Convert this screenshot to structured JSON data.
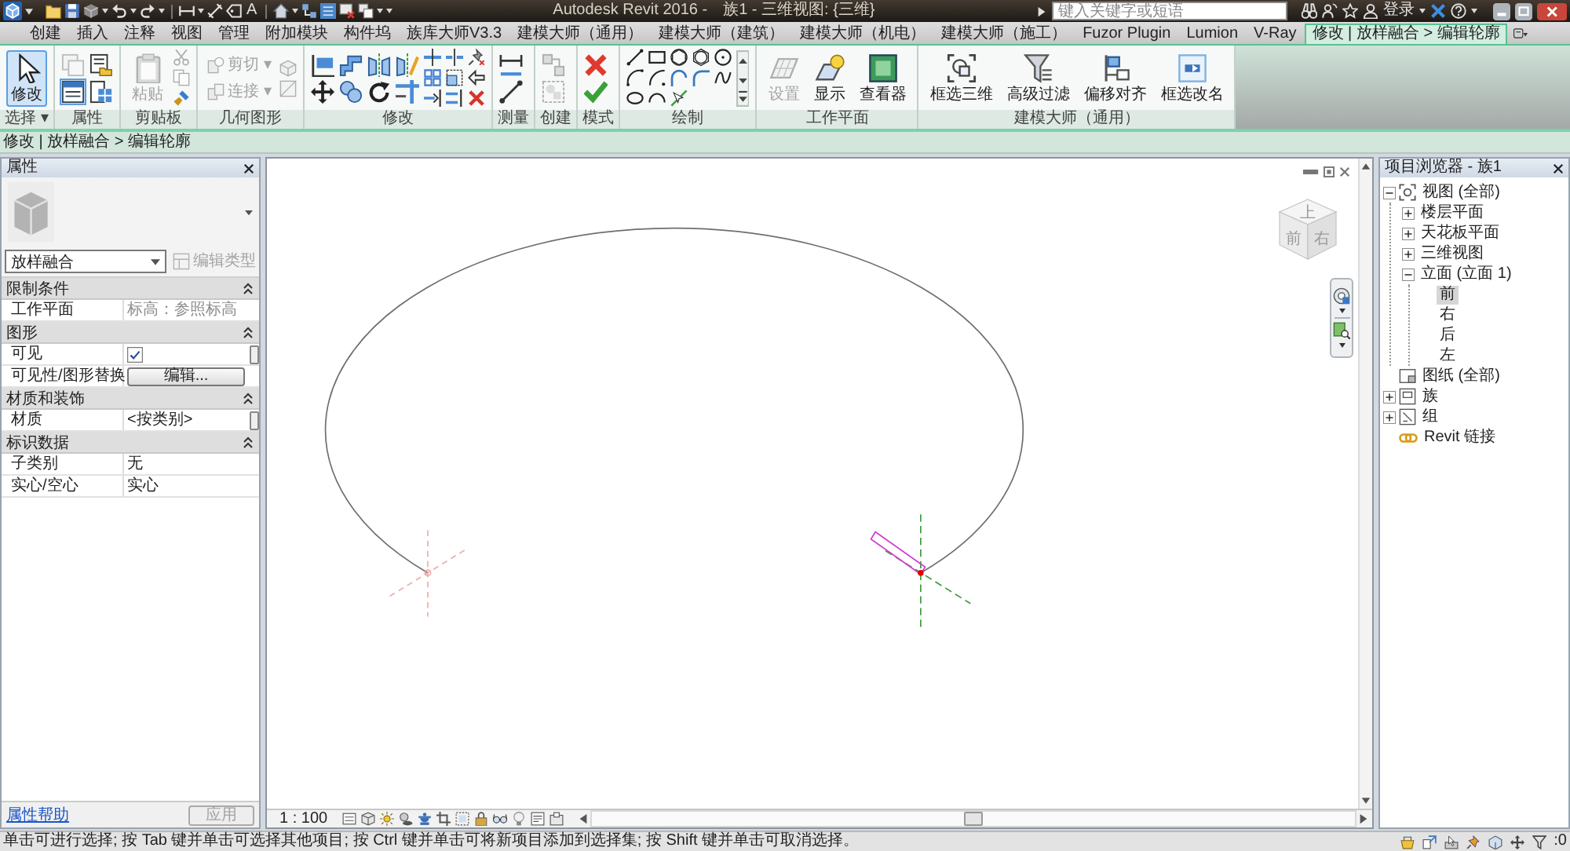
{
  "title_bar": {
    "text_tool": "A",
    "app_title": "Autodesk Revit 2016 -",
    "document": "族1 - 三维视图: {三维}",
    "search": {
      "placeholder": "键入关键字或短语"
    },
    "sign_in": "登录"
  },
  "ribbon_tabs": [
    {
      "label": "创建",
      "selected": false
    },
    {
      "label": "插入",
      "selected": false
    },
    {
      "label": "注释",
      "selected": false
    },
    {
      "label": "视图",
      "selected": false
    },
    {
      "label": "管理",
      "selected": false
    },
    {
      "label": "附加模块",
      "selected": false
    },
    {
      "label": "构件坞",
      "selected": false
    },
    {
      "label": "族库大师V3.3",
      "selected": false
    },
    {
      "label": "建模大师（通用）",
      "selected": false
    },
    {
      "label": "建模大师（建筑）",
      "selected": false
    },
    {
      "label": "建模大师（机电）",
      "selected": false
    },
    {
      "label": "建模大师（施工）",
      "selected": false
    },
    {
      "label": "Fuzor Plugin",
      "selected": false
    },
    {
      "label": "Lumion",
      "selected": false
    },
    {
      "label": "V-Ray",
      "selected": false
    },
    {
      "label": "修改 | 放样融合 > 编辑轮廓",
      "selected": true
    }
  ],
  "ribbon_panels": [
    {
      "label": "选择 ▾",
      "tools": [
        {
          "kind": "large",
          "label": "修改",
          "on": true,
          "disabled": false
        }
      ]
    },
    {
      "label": "属性",
      "tools": [
        {
          "kind": "medium",
          "on": false,
          "disabled": true
        },
        {
          "kind": "medium",
          "on": false,
          "disabled": false
        },
        {
          "kind": "medium",
          "on": true,
          "disabled": false
        },
        {
          "kind": "medium",
          "on": false,
          "disabled": false
        }
      ]
    },
    {
      "label": "剪贴板",
      "tools": [
        {
          "kind": "large",
          "label": "粘贴",
          "disabled": true
        },
        {
          "kind": "small",
          "disabled": true
        },
        {
          "kind": "small",
          "disabled": true
        },
        {
          "kind": "small",
          "disabled": false
        }
      ]
    },
    {
      "label": "几何图形",
      "tools": [
        {
          "kind": "split",
          "label": "剪切 ▾",
          "disabled": true
        },
        {
          "kind": "split",
          "label": "连接 ▾",
          "disabled": true
        },
        {
          "kind": "small",
          "disabled": true
        },
        {
          "kind": "small",
          "disabled": true
        }
      ]
    },
    {
      "label": "修改",
      "tools": [
        {
          "kind": "medium",
          "disabled": false
        },
        {
          "kind": "medium",
          "disabled": false
        },
        {
          "kind": "medium",
          "disabled": false
        },
        {
          "kind": "medium",
          "disabled": false
        },
        {
          "kind": "medium",
          "disabled": false
        },
        {
          "kind": "medium",
          "disabled": false
        },
        {
          "kind": "medium",
          "disabled": false
        },
        {
          "kind": "medium",
          "disabled": false
        },
        {
          "kind": "small",
          "disabled": false
        },
        {
          "kind": "small",
          "disabled": false
        },
        {
          "kind": "small",
          "disabled": false
        },
        {
          "kind": "small",
          "disabled": false
        },
        {
          "kind": "small",
          "disabled": false
        },
        {
          "kind": "small",
          "disabled": false
        },
        {
          "kind": "small",
          "disabled": false
        },
        {
          "kind": "small",
          "disabled": false
        },
        {
          "kind": "small",
          "disabled": false
        }
      ]
    },
    {
      "label": "测量",
      "tools": [
        {
          "kind": "medium",
          "disabled": false
        },
        {
          "kind": "medium",
          "disabled": false
        }
      ]
    },
    {
      "label": "创建",
      "tools": [
        {
          "kind": "medium",
          "disabled": true
        },
        {
          "kind": "medium",
          "disabled": true
        }
      ]
    },
    {
      "label": "模式",
      "tools": [
        {
          "kind": "medium",
          "disabled": false
        },
        {
          "kind": "medium",
          "disabled": false
        }
      ]
    },
    {
      "label": "绘制",
      "tools": [
        {
          "kind": "small",
          "disabled": false
        },
        {
          "kind": "small",
          "disabled": false
        },
        {
          "kind": "small",
          "disabled": false
        },
        {
          "kind": "small",
          "disabled": false
        },
        {
          "kind": "small",
          "disabled": false
        },
        {
          "kind": "small",
          "disabled": false
        },
        {
          "kind": "small",
          "disabled": false
        },
        {
          "kind": "small",
          "disabled": false
        },
        {
          "kind": "small",
          "disabled": false
        },
        {
          "kind": "small",
          "disabled": false
        },
        {
          "kind": "small",
          "disabled": false
        },
        {
          "kind": "small",
          "disabled": false
        },
        {
          "kind": "small",
          "disabled": false
        }
      ]
    },
    {
      "label": "工作平面",
      "tools": [
        {
          "kind": "large",
          "label": "设置",
          "disabled": true
        },
        {
          "kind": "large",
          "label": "显示",
          "disabled": false
        },
        {
          "kind": "large",
          "label": "查看器",
          "disabled": false
        }
      ]
    },
    {
      "label": "建模大师（通用）",
      "tools": [
        {
          "kind": "large",
          "label": "框选三维",
          "disabled": false
        },
        {
          "kind": "large",
          "label": "高级过滤",
          "disabled": false
        },
        {
          "kind": "large",
          "label": "偏移对齐",
          "disabled": false
        },
        {
          "kind": "large",
          "label": "框选改名",
          "disabled": false
        }
      ]
    }
  ],
  "options_bar": {
    "context": "修改 | 放样融合 > 编辑轮廓"
  },
  "properties": {
    "title": "属性",
    "type_name": "放样融合",
    "edit_type": {
      "label": "编辑类型",
      "disabled": true
    },
    "groups": [
      {
        "name": "限制条件",
        "expanded": true,
        "rows": [
          {
            "kind": "text",
            "label": "工作平面",
            "value": "标高：参照标高",
            "disabled": true,
            "linkable": false
          }
        ]
      },
      {
        "name": "图形",
        "expanded": true,
        "rows": [
          {
            "kind": "checkbox",
            "label": "可见",
            "checked": true,
            "disabled": false,
            "linkable": true
          },
          {
            "kind": "button",
            "label": "可见性/图形替换",
            "value": "编辑...",
            "disabled": false,
            "linkable": false
          }
        ]
      },
      {
        "name": "材质和装饰",
        "expanded": true,
        "rows": [
          {
            "kind": "text",
            "label": "材质",
            "value": "<按类别>",
            "disabled": false,
            "linkable": true
          }
        ]
      },
      {
        "name": "标识数据",
        "expanded": true,
        "rows": [
          {
            "kind": "text",
            "label": "子类别",
            "value": "无",
            "disabled": false,
            "linkable": false
          },
          {
            "kind": "text",
            "label": "实心/空心",
            "value": "实心",
            "disabled": false,
            "linkable": false
          }
        ]
      }
    ],
    "help_link": "属性帮助",
    "apply": {
      "label": "应用",
      "disabled": true
    }
  },
  "view": {
    "cube_faces": {
      "top": "上",
      "front": "前",
      "right": "右"
    },
    "scale": "1 : 100"
  },
  "project_browser": {
    "title": "项目浏览器 - 族1",
    "tree": [
      {
        "label": "视图 (全部)",
        "expanded": true,
        "selected": false,
        "children": [
          {
            "label": "楼层平面",
            "expanded": false,
            "selected": false
          },
          {
            "label": "天花板平面",
            "expanded": false,
            "selected": false
          },
          {
            "label": "三维视图",
            "expanded": false,
            "selected": false
          },
          {
            "label": "立面 (立面 1)",
            "expanded": true,
            "selected": false,
            "children": [
              {
                "label": "前",
                "selected": true
              },
              {
                "label": "右",
                "selected": false
              },
              {
                "label": "后",
                "selected": false
              },
              {
                "label": "左",
                "selected": false
              }
            ]
          }
        ]
      },
      {
        "label": "图纸 (全部)",
        "selected": false
      },
      {
        "label": "族",
        "expanded": false,
        "selected": false
      },
      {
        "label": "组",
        "expanded": false,
        "selected": false
      },
      {
        "label": "Revit 链接",
        "selected": false
      }
    ]
  },
  "status_bar": {
    "message": "单击可进行选择; 按 Tab 键并单击可选择其他项目; 按 Ctrl 键并单击可将新项目添加到选择集; 按 Shift 键并单击可取消选择。",
    "filter_count": ":0"
  }
}
